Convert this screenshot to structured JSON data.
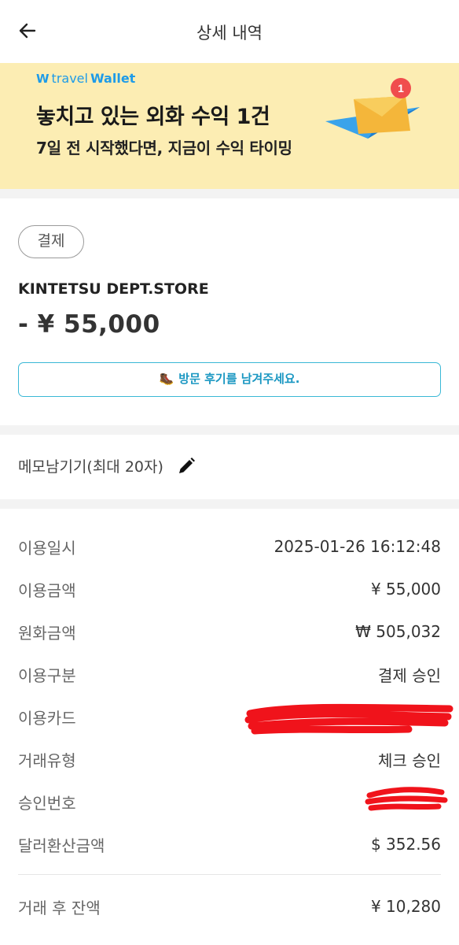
{
  "header": {
    "title": "상세 내역",
    "back_icon": "arrow-left-icon"
  },
  "banner": {
    "brand_prefix": "W",
    "brand_travel": "travel",
    "brand_wallet": "Wallet",
    "title": "놓치고 있는 외화 수익 1건",
    "subtitle": "7일 전 시작했다면, 지금이 수익 타이밍",
    "badge_count": "1",
    "illustration_icon": "paper-plane-envelope-icon",
    "bg_color": "#fcedb3",
    "brand_color": "#1e9be8"
  },
  "transaction": {
    "type_chip": "결제",
    "merchant": "KINTETSU DEPT.STORE",
    "amount": "- ¥ 55,000",
    "review_emoji": "🥾",
    "review_label": "방문 후기를 남겨주세요."
  },
  "memo": {
    "label": "메모남기기(최대 20자)",
    "icon": "pencil-icon"
  },
  "details": [
    {
      "label": "이용일시",
      "value": "2025-01-26 16:12:48"
    },
    {
      "label": "이용금액",
      "value": "¥ 55,000"
    },
    {
      "label": "원화금액",
      "value": "₩ 505,032"
    },
    {
      "label": "이용구분",
      "value": "결제 승인"
    },
    {
      "label": "이용카드",
      "value": ""
    },
    {
      "label": "거래유형",
      "value": "체크 승인"
    },
    {
      "label": "승인번호",
      "value": ""
    },
    {
      "label": "달러환산금액",
      "value": "$ 352.56"
    }
  ],
  "balance": {
    "label": "거래 후 잔액",
    "value": "¥ 10,280"
  }
}
